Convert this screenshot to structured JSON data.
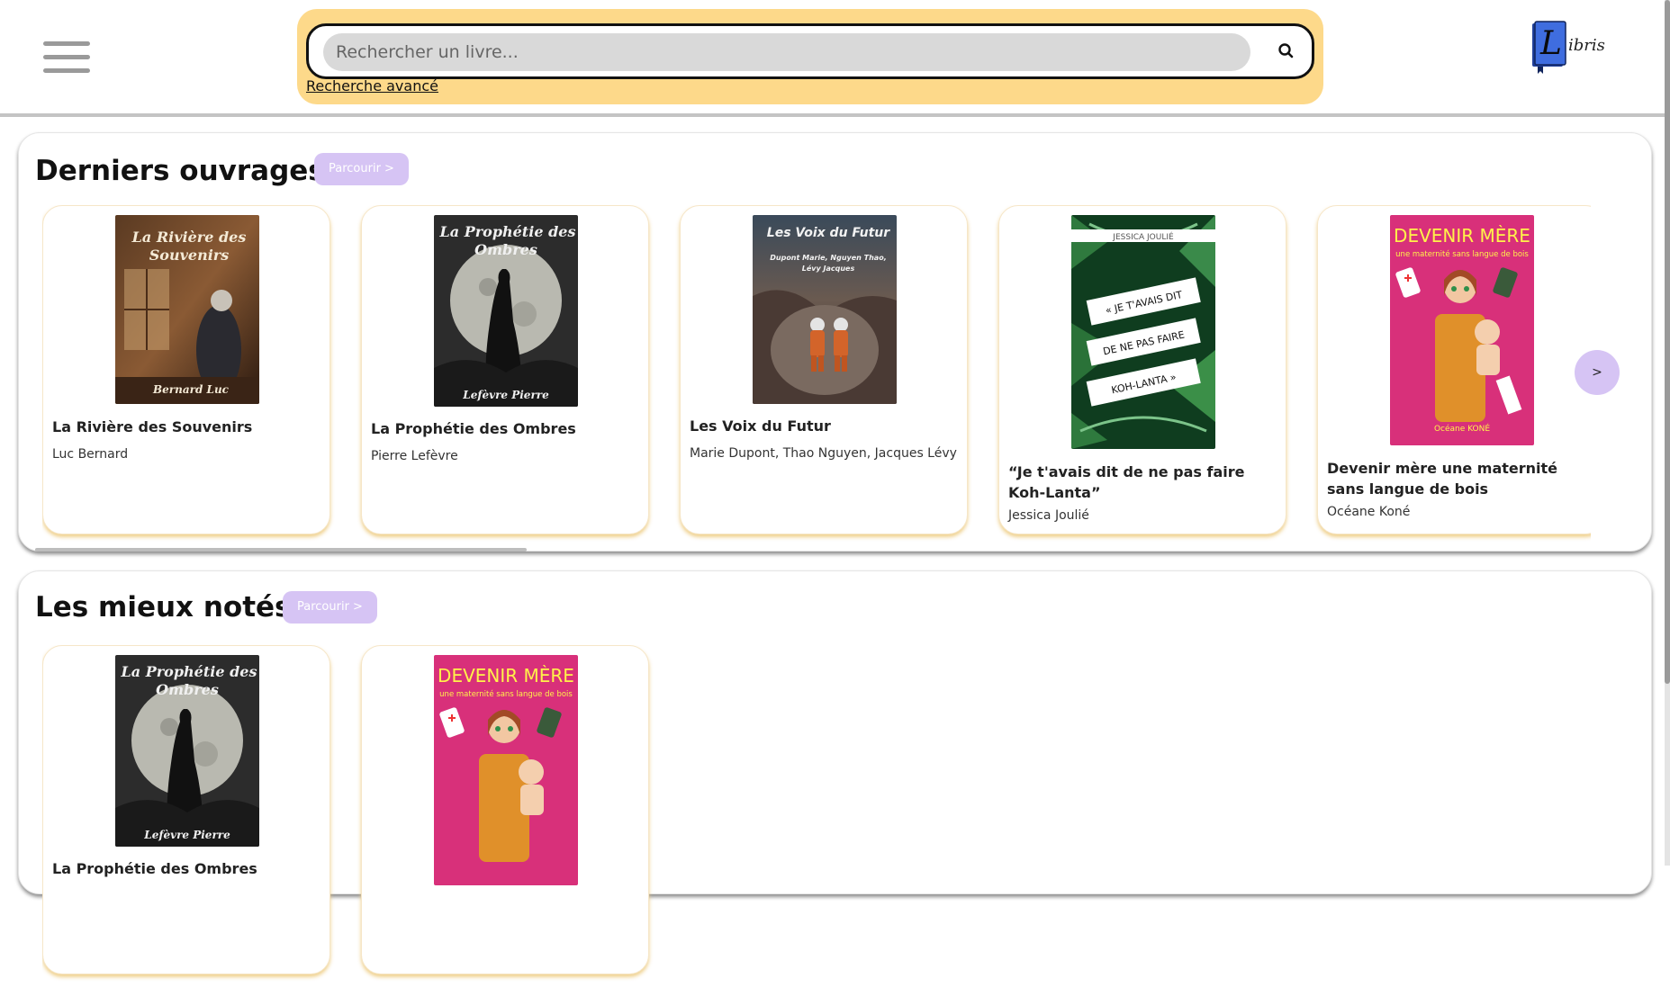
{
  "header": {
    "search_placeholder": "Rechercher un livre...",
    "advanced_search": "Recherche avancé",
    "logo_letter": "L",
    "logo_text": "ibris"
  },
  "sections": [
    {
      "title": "Derniers ouvrages",
      "browse": "Parcourir >",
      "next": ">",
      "books": [
        {
          "title": "La Rivière des Souvenirs",
          "author": "Luc Bernard",
          "cover_title": "La Rivière des Souvenirs",
          "cover_title_l1": "La Rivière des",
          "cover_title_l2": "Souvenirs",
          "cover_author": "Bernard Luc"
        },
        {
          "title": "La Prophétie des Ombres",
          "author": "Pierre Lefèvre",
          "cover_title_l1": "La Prophétie des",
          "cover_title_l2": "Ombres",
          "cover_author": "Lefèvre Pierre"
        },
        {
          "title": "Les Voix du Futur",
          "author": "Marie Dupont, Thao Nguyen, Jacques Lévy",
          "cover_title_l1": "Les Voix du Futur",
          "cover_sub_l1": "Dupont Marie, Nguyen Thao,",
          "cover_sub_l2": "Lévy Jacques"
        },
        {
          "title": "“Je t'avais dit de ne pas faire Koh-Lanta”",
          "author": "Jessica Joulié",
          "cover_top": "JESSICA JOULIÉ",
          "cover_l1": "« JE T'AVAIS DIT",
          "cover_l2": "DE NE PAS FAIRE",
          "cover_l3": "KOH-LANTA »"
        },
        {
          "title": "Devenir mère une maternité sans langue de bois",
          "author": "Océane Koné",
          "cover_l1": "DEVENIR MÈRE",
          "cover_l2": "une maternité sans langue de bois",
          "cover_author": "Océane KONÉ"
        }
      ]
    },
    {
      "title": "Les mieux notés",
      "browse": "Parcourir >",
      "books": [
        {
          "title": "La Prophétie des Ombres",
          "cover_title_l1": "La Prophétie des",
          "cover_title_l2": "Ombres",
          "cover_author": "Lefèvre Pierre"
        },
        {
          "cover_l1": "DEVENIR MÈRE",
          "cover_l2": "une maternité sans langue de bois"
        }
      ]
    }
  ]
}
